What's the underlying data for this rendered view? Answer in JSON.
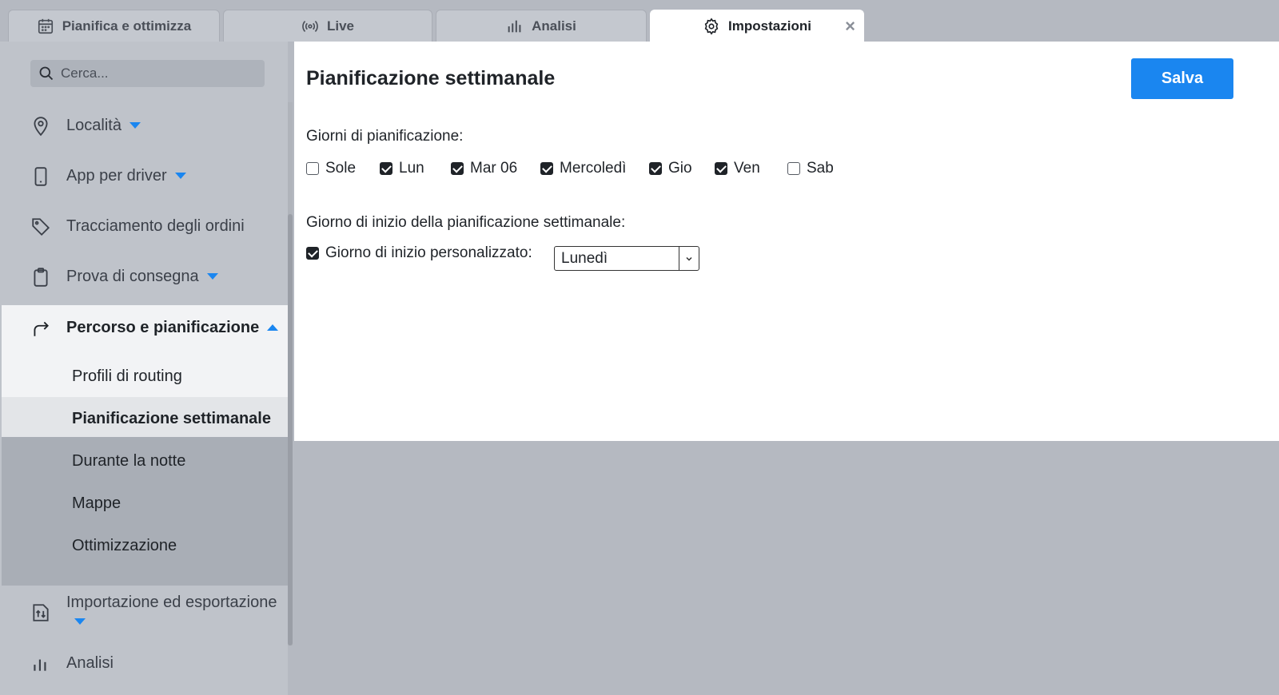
{
  "tabs": [
    {
      "label": "Pianifica e ottimizza",
      "icon": "calendar-icon"
    },
    {
      "label": "Live",
      "icon": "broadcast-icon"
    },
    {
      "label": "Analisi",
      "icon": "bar-chart-icon"
    },
    {
      "label": "Impostazioni",
      "icon": "gear-icon",
      "active": true,
      "close_label": "×"
    }
  ],
  "sidebar": {
    "search_placeholder": "Cerca...",
    "items": [
      {
        "label": "Località",
        "icon": "location-pin-icon",
        "caret": "down"
      },
      {
        "label": "App per driver",
        "icon": "phone-icon",
        "caret": "down"
      },
      {
        "label": "Tracciamento degli ordini",
        "icon": "tag-icon"
      },
      {
        "label": "Prova di consegna",
        "icon": "clipboard-icon",
        "caret": "down"
      },
      {
        "label": "Percorso e pianificazione",
        "icon": "route-arrow-icon",
        "caret": "up"
      },
      {
        "label": "Importazione ed esportazione",
        "icon": "import-export-icon",
        "caret": "down"
      },
      {
        "label": "Analisi",
        "icon": "bar-chart-icon"
      }
    ],
    "subitems": [
      {
        "label": "Profili di routing"
      },
      {
        "label": "Pianificazione settimanale",
        "selected": true
      },
      {
        "label": "Durante la notte"
      },
      {
        "label": "Mappe"
      },
      {
        "label": "Ottimizzazione"
      }
    ]
  },
  "main": {
    "title": "Pianificazione settimanale",
    "save_label": "Salva",
    "days_label": "Giorni di pianificazione:",
    "days": [
      {
        "label": "Sole",
        "checked": false
      },
      {
        "label": "Lun",
        "checked": true
      },
      {
        "label": "Mar 06",
        "checked": true
      },
      {
        "label": "Mercoledì",
        "checked": true
      },
      {
        "label": "Gio",
        "checked": true
      },
      {
        "label": "Ven",
        "checked": true
      },
      {
        "label": "Sab",
        "checked": false
      }
    ],
    "start_label": "Giorno di inizio della pianificazione settimanale:",
    "custom_start_label": "Giorno di inizio personalizzato:",
    "custom_start_checked": true,
    "start_day_value": "Lunedì"
  },
  "colors": {
    "accent": "#1a86f0"
  }
}
